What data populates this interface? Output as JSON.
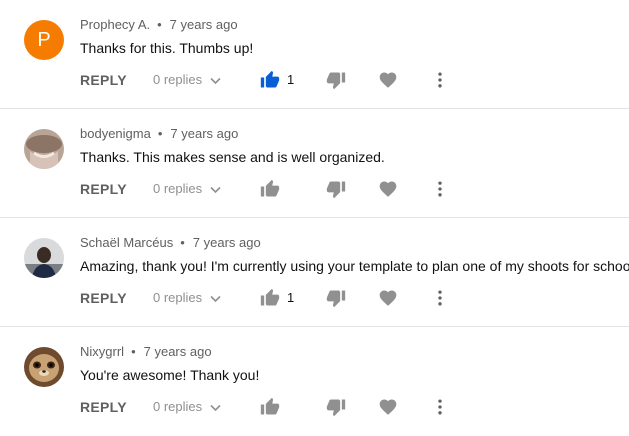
{
  "comments": [
    {
      "author": "Prophecy A.",
      "time": "7 years ago",
      "text": "Thanks for this. Thumbs up!",
      "avatar_letter": "P",
      "reply_label": "REPLY",
      "replies_label": "0 replies",
      "likes": "1",
      "liked": true
    },
    {
      "author": "bodyenigma",
      "time": "7 years ago",
      "text": "Thanks. This makes sense and is well organized.",
      "avatar_letter": "",
      "reply_label": "REPLY",
      "replies_label": "0 replies",
      "likes": "",
      "liked": false
    },
    {
      "author": "Schaël Marcéus",
      "time": "7 years ago",
      "text": "Amazing, thank you! I'm currently using your template to plan one of my shoots for school.",
      "avatar_letter": "",
      "reply_label": "REPLY",
      "replies_label": "0 replies",
      "likes": "1",
      "liked": false
    },
    {
      "author": "Nixygrrl",
      "time": "7 years ago",
      "text": "You're awesome! Thank you!",
      "avatar_letter": "",
      "reply_label": "REPLY",
      "replies_label": "0 replies",
      "likes": "",
      "liked": false
    }
  ],
  "icons": {
    "separator": "•",
    "like": "thumbs-up-icon",
    "dislike": "thumbs-down-icon",
    "heart": "heart-icon",
    "more": "more-vertical-icon",
    "expand": "chevron-down-icon"
  },
  "colors": {
    "liked": "#065fd4",
    "icon": "#909090",
    "avatar_p": "#f57c00"
  }
}
